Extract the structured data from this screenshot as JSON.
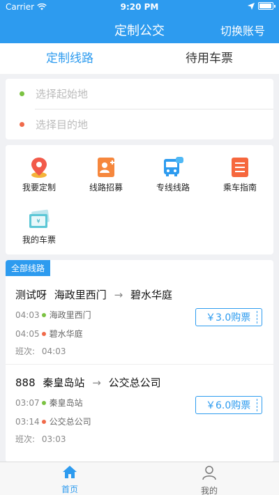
{
  "status": {
    "carrier": "Carrier",
    "time": "9:20 PM"
  },
  "header": {
    "title": "定制公交",
    "switch_account": "切换账号"
  },
  "tabs": [
    {
      "label": "定制线路",
      "active": true
    },
    {
      "label": "待用车票",
      "active": false
    }
  ],
  "route_input": {
    "start_placeholder": "选择起始地",
    "end_placeholder": "选择目的地"
  },
  "menu": [
    {
      "label": "我要定制",
      "icon": "location-pin-icon"
    },
    {
      "label": "线路招募",
      "icon": "recruit-icon"
    },
    {
      "label": "专线线路",
      "icon": "bus-icon"
    },
    {
      "label": "乘车指南",
      "icon": "guide-icon"
    },
    {
      "label": "我的车票",
      "icon": "ticket-icon"
    }
  ],
  "route_list": {
    "tag": "全部线路",
    "items": [
      {
        "name": "测试呀",
        "from": "海政里西门",
        "arrow": "→",
        "to": "碧水华庭",
        "stops": [
          {
            "time": "04:03",
            "name": "海政里西门"
          },
          {
            "time": "04:05",
            "name": "碧水华庭"
          }
        ],
        "shift_label": "班次:",
        "shift_time": "04:03",
        "price": "￥3.0购票"
      },
      {
        "name": "888",
        "from": "秦皇岛站",
        "arrow": "→",
        "to": "公交总公司",
        "stops": [
          {
            "time": "03:07",
            "name": "秦皇岛站"
          },
          {
            "time": "03:14",
            "name": "公交总公司"
          }
        ],
        "shift_label": "班次:",
        "shift_time": "03:03",
        "price": "￥6.0购票"
      }
    ]
  },
  "bottom_nav": [
    {
      "label": "首页",
      "active": true
    },
    {
      "label": "我的",
      "active": false
    }
  ],
  "colors": {
    "primary": "#2d9bef",
    "start_dot": "#7bc242",
    "end_dot": "#f06a4a"
  }
}
